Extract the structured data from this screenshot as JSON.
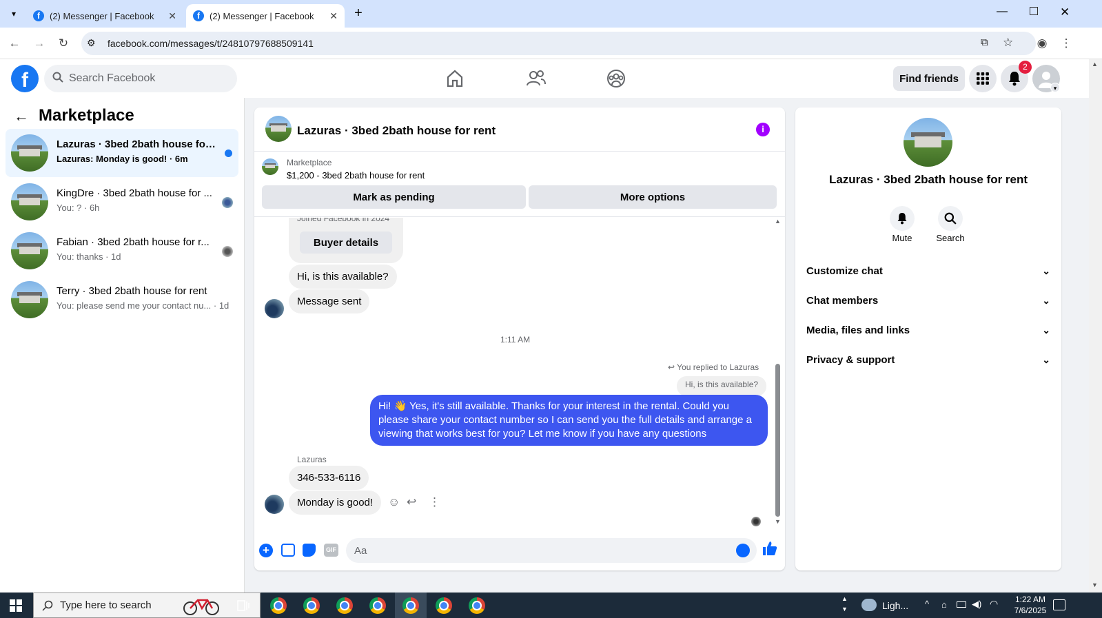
{
  "browser": {
    "tabs": [
      {
        "label": "(2) Messenger | Facebook"
      },
      {
        "label": "(2) Messenger | Facebook"
      }
    ],
    "url": "facebook.com/messages/t/24810797688509141"
  },
  "header": {
    "search_placeholder": "Search Facebook",
    "find_friends": "Find friends",
    "notification_count": "2"
  },
  "left": {
    "title": "Marketplace",
    "conversations": [
      {
        "name": "Lazuras · 3bed 2bath house for r...",
        "preview": "Lazuras: Monday is good! · 6m"
      },
      {
        "name": "KingDre · 3bed 2bath house for ...",
        "preview": "You: ? · 6h"
      },
      {
        "name": "Fabian · 3bed 2bath house for r...",
        "preview": "You: thanks · 1d"
      },
      {
        "name": "Terry · 3bed 2bath house for rent",
        "preview": "You: please send me your contact nu...  · 1d"
      }
    ]
  },
  "chat": {
    "title": "Lazuras · 3bed 2bath house for rent",
    "marketplace_label": "Marketplace",
    "listing": "$1,200 - 3bed 2bath house for rent",
    "mark_pending": "Mark as pending",
    "more_options": "More options",
    "joined": "Joined Facebook in 2024",
    "buyer_details": "Buyer details",
    "msg1": "Hi, is this available?",
    "msg2": "Message sent",
    "timestamp": "1:11 AM",
    "replied_to": "You replied to Lazuras",
    "quoted": "Hi, is this available?",
    "outgoing": "Hi! 👋 Yes, it's still available. Thanks for your interest in the rental. Could you please share your contact number so I can send you the full details and arrange a viewing that works best for you? Let me know if you have any questions",
    "sender_name": "Lazuras",
    "msg3": "346-533-6116",
    "msg4": "Monday is good!",
    "input_placeholder": "Aa"
  },
  "right": {
    "title": "Lazuras · 3bed 2bath house for rent",
    "mute": "Mute",
    "search": "Search",
    "sections": [
      "Customize chat",
      "Chat members",
      "Media, files and links",
      "Privacy & support"
    ]
  },
  "taskbar": {
    "search_placeholder": "Type here to search",
    "weather": "Ligh...",
    "time": "1:22 AM",
    "date": "7/6/2025"
  },
  "colors": {
    "fb_blue": "#1877f2",
    "outgoing_bubble": "#3d56f0",
    "badge_red": "#e41e3f"
  }
}
